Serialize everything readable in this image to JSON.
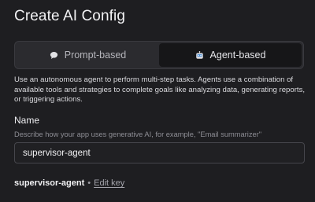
{
  "dialog": {
    "title": "Create AI Config"
  },
  "mode_toggle": {
    "options": [
      {
        "label": "Prompt-based",
        "icon": "chat-bubble-icon",
        "selected": false
      },
      {
        "label": "Agent-based",
        "icon": "robot-icon",
        "selected": true
      }
    ]
  },
  "description": "Use an autonomous agent to perform multi-step tasks. Agents use a combination of available tools and strategies to complete goals like analyzing data, generating reports, or triggering actions.",
  "name_field": {
    "label": "Name",
    "help": "Describe how your app uses generative AI, for example, \"Email summarizer\"",
    "value": "supervisor-agent"
  },
  "key": {
    "value": "supervisor-agent",
    "separator": "•",
    "edit_label": "Edit key"
  }
}
